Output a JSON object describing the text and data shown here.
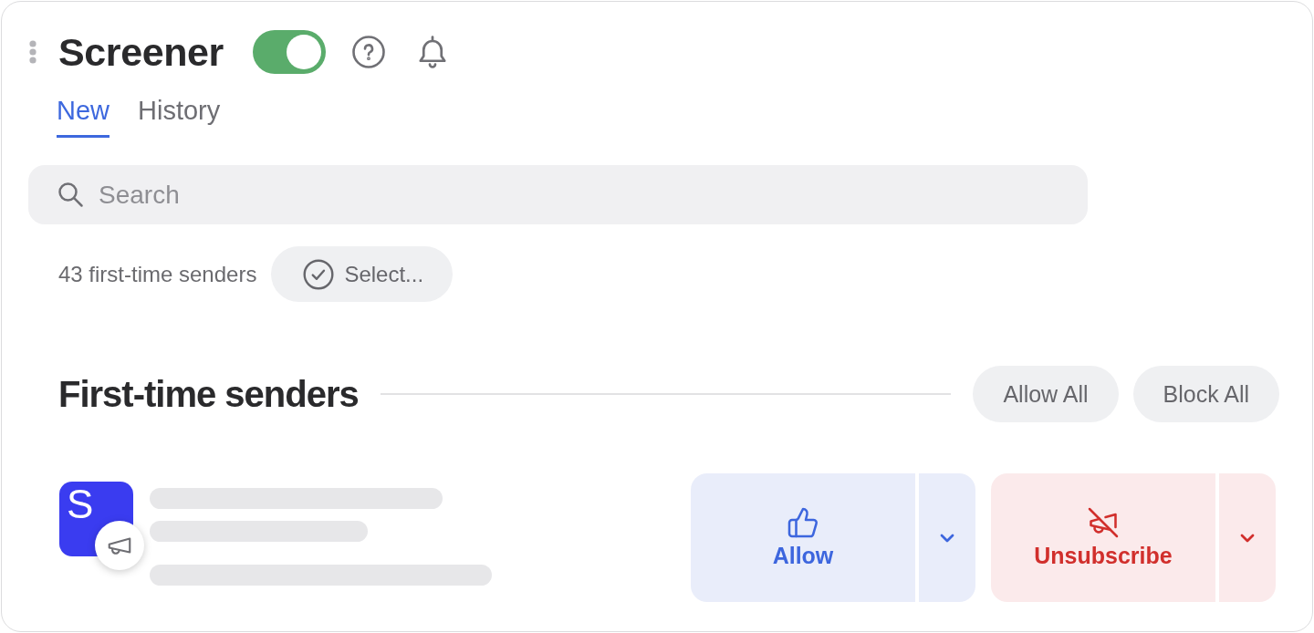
{
  "header": {
    "title": "Screener",
    "enabled": true
  },
  "tabs": [
    {
      "label": "New",
      "selected": true
    },
    {
      "label": "History",
      "selected": false
    }
  ],
  "search": {
    "placeholder": "Search"
  },
  "summary": {
    "count": "43 first-time senders",
    "select_label": "Select..."
  },
  "section": {
    "title": "First-time senders",
    "buttons": [
      "Allow All",
      "Block All"
    ]
  },
  "senders": [
    {
      "initial": "S",
      "color": "#3a3cf0",
      "loading": true,
      "actions": [
        {
          "kind": "allow",
          "label": "Allow"
        },
        {
          "kind": "unsubscribe",
          "label": "Unsubscribe"
        }
      ]
    }
  ]
}
